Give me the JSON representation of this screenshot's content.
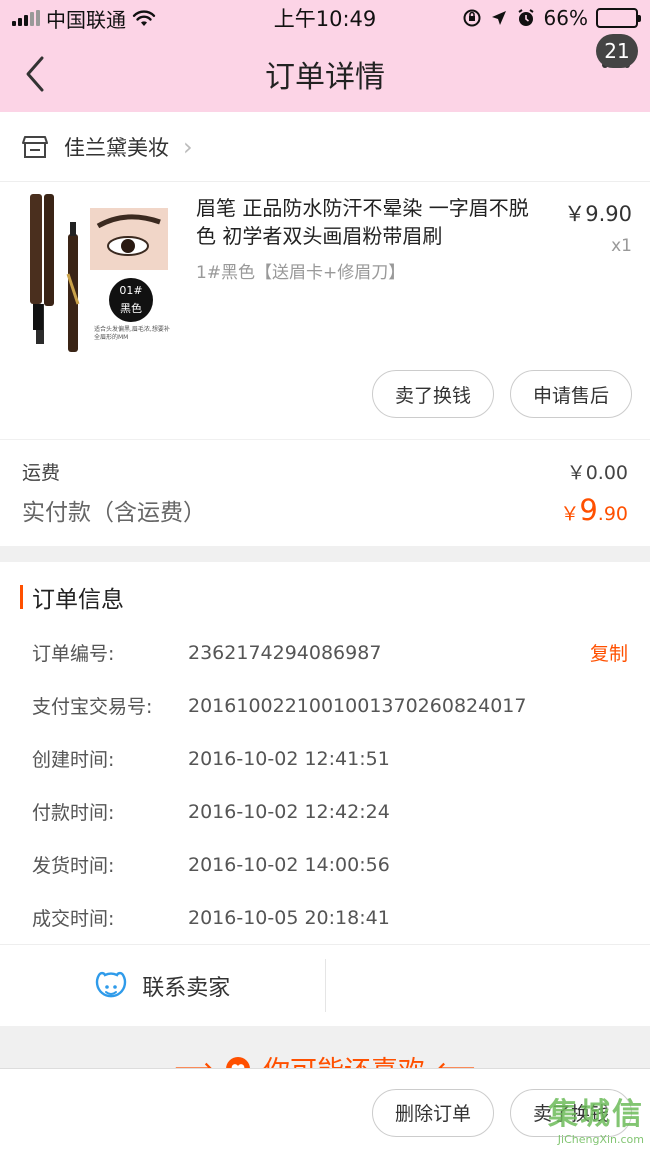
{
  "status_bar": {
    "carrier": "中国联通",
    "time": "上午10:49",
    "battery": "66%"
  },
  "nav": {
    "title": "订单详情",
    "badge": "21"
  },
  "shop": {
    "name": "佳兰黛美妆"
  },
  "product": {
    "name": "眉笔 正品防水防汗不晕染 一字眉不脱色 初学者双头画眉粉带眉刷",
    "sku": "1#黑色【送眉卡+修眉刀】",
    "price": "￥9.90",
    "quantity": "x1",
    "thumb_tag_num": "01#",
    "thumb_tag_color": "黑色",
    "thumb_caption": "适合头发偏黑,眉毛浓,想要补全眉形的MM"
  },
  "item_actions": {
    "sell": "卖了换钱",
    "after_sale": "申请售后"
  },
  "totals": {
    "freight_label": "运费",
    "freight_value": "￥0.00",
    "paid_label": "实付款（含运费）",
    "paid_symbol": "￥",
    "paid_int": "9",
    "paid_dec": ".90"
  },
  "order_info": {
    "title": "订单信息",
    "copy_label": "复制",
    "rows": [
      {
        "key": "订单编号:",
        "value": "2362174294086987"
      },
      {
        "key": "支付宝交易号:",
        "value": "2016100221001001370260824017"
      },
      {
        "key": "创建时间:",
        "value": "2016-10-02 12:41:51"
      },
      {
        "key": "付款时间:",
        "value": "2016-10-02 12:42:24"
      },
      {
        "key": "发货时间:",
        "value": "2016-10-02 14:00:56"
      },
      {
        "key": "成交时间:",
        "value": "2016-10-05 20:18:41"
      }
    ]
  },
  "contact": {
    "label": "联系卖家"
  },
  "recommend": {
    "label": "你可能还喜欢"
  },
  "bottom_bar": {
    "delete": "删除订单",
    "sell": "卖了换钱"
  },
  "watermark": {
    "text": "集城信",
    "url": "JiChengXin.com"
  },
  "colors": {
    "accent": "#ff5000",
    "nav_bg": "#fcd4e6"
  }
}
